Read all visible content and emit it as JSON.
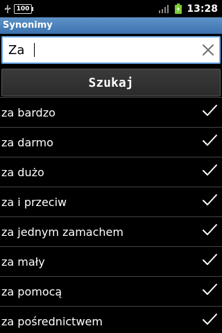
{
  "status_bar": {
    "battery_text": "100",
    "time": "13:28"
  },
  "app": {
    "title": "Synonimy"
  },
  "search": {
    "value": "Za",
    "placeholder": ""
  },
  "button": {
    "label": "Szukaj"
  },
  "results": [
    {
      "label": "za bardzo",
      "icon": "check-icon"
    },
    {
      "label": "za darmo",
      "icon": "check-icon"
    },
    {
      "label": "za dużo",
      "icon": "check-icon"
    },
    {
      "label": "za i przeciw",
      "icon": "check-icon"
    },
    {
      "label": "za jednym zamachem",
      "icon": "check-icon"
    },
    {
      "label": "za mały",
      "icon": "check-icon"
    },
    {
      "label": "za pomocą",
      "icon": "check-icon"
    },
    {
      "label": "za pośrednictwem",
      "icon": "check-icon"
    }
  ],
  "colors": {
    "title_bar": "#4a7fb8",
    "search_border": "#69a8e6",
    "background": "#000000"
  }
}
